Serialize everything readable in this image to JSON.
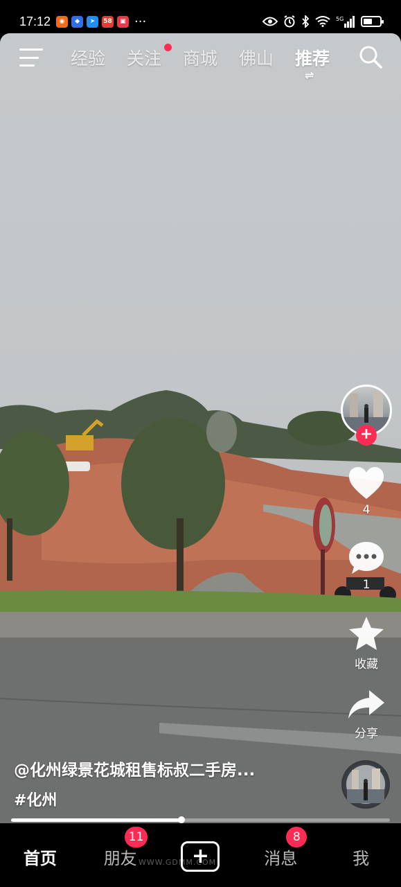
{
  "status_bar": {
    "time": "17:12",
    "more": "···",
    "network": "5G",
    "battery_level": 0.55,
    "apps": [
      {
        "icon": "orange-app-icon",
        "color": "#f26b1d",
        "text": ""
      },
      {
        "icon": "blue-shield-app-icon",
        "color": "#2e6fe8",
        "text": ""
      },
      {
        "icon": "blue-arrow-app-icon",
        "color": "#1f8ef1",
        "text": ""
      },
      {
        "icon": "58-app-icon",
        "color": "#e83b2f",
        "text": "58"
      },
      {
        "icon": "red-app-icon",
        "color": "#e8394a",
        "text": ""
      }
    ]
  },
  "top_nav": {
    "tabs": [
      "经验",
      "关注",
      "商城",
      "佛山",
      "推荐"
    ],
    "active_tab": "推荐",
    "swap_glyph": "⇌"
  },
  "right_rail": {
    "like_count": "4",
    "comment_count": "1",
    "favorite_label": "收藏",
    "share_label": "分享",
    "follow_glyph": "+"
  },
  "caption": {
    "author": "@化州绿景花城租售标叔二手房...",
    "hashtag": "#化州"
  },
  "progress": {
    "fraction": 0.45
  },
  "bottom_nav": {
    "home": "首页",
    "friends": "朋友",
    "friends_badge": "11",
    "create": "+",
    "messages": "消息",
    "messages_badge": "8",
    "me": "我"
  },
  "watermark": "WWW.GDMM.COM",
  "colors": {
    "accent": "#fe2c55"
  }
}
